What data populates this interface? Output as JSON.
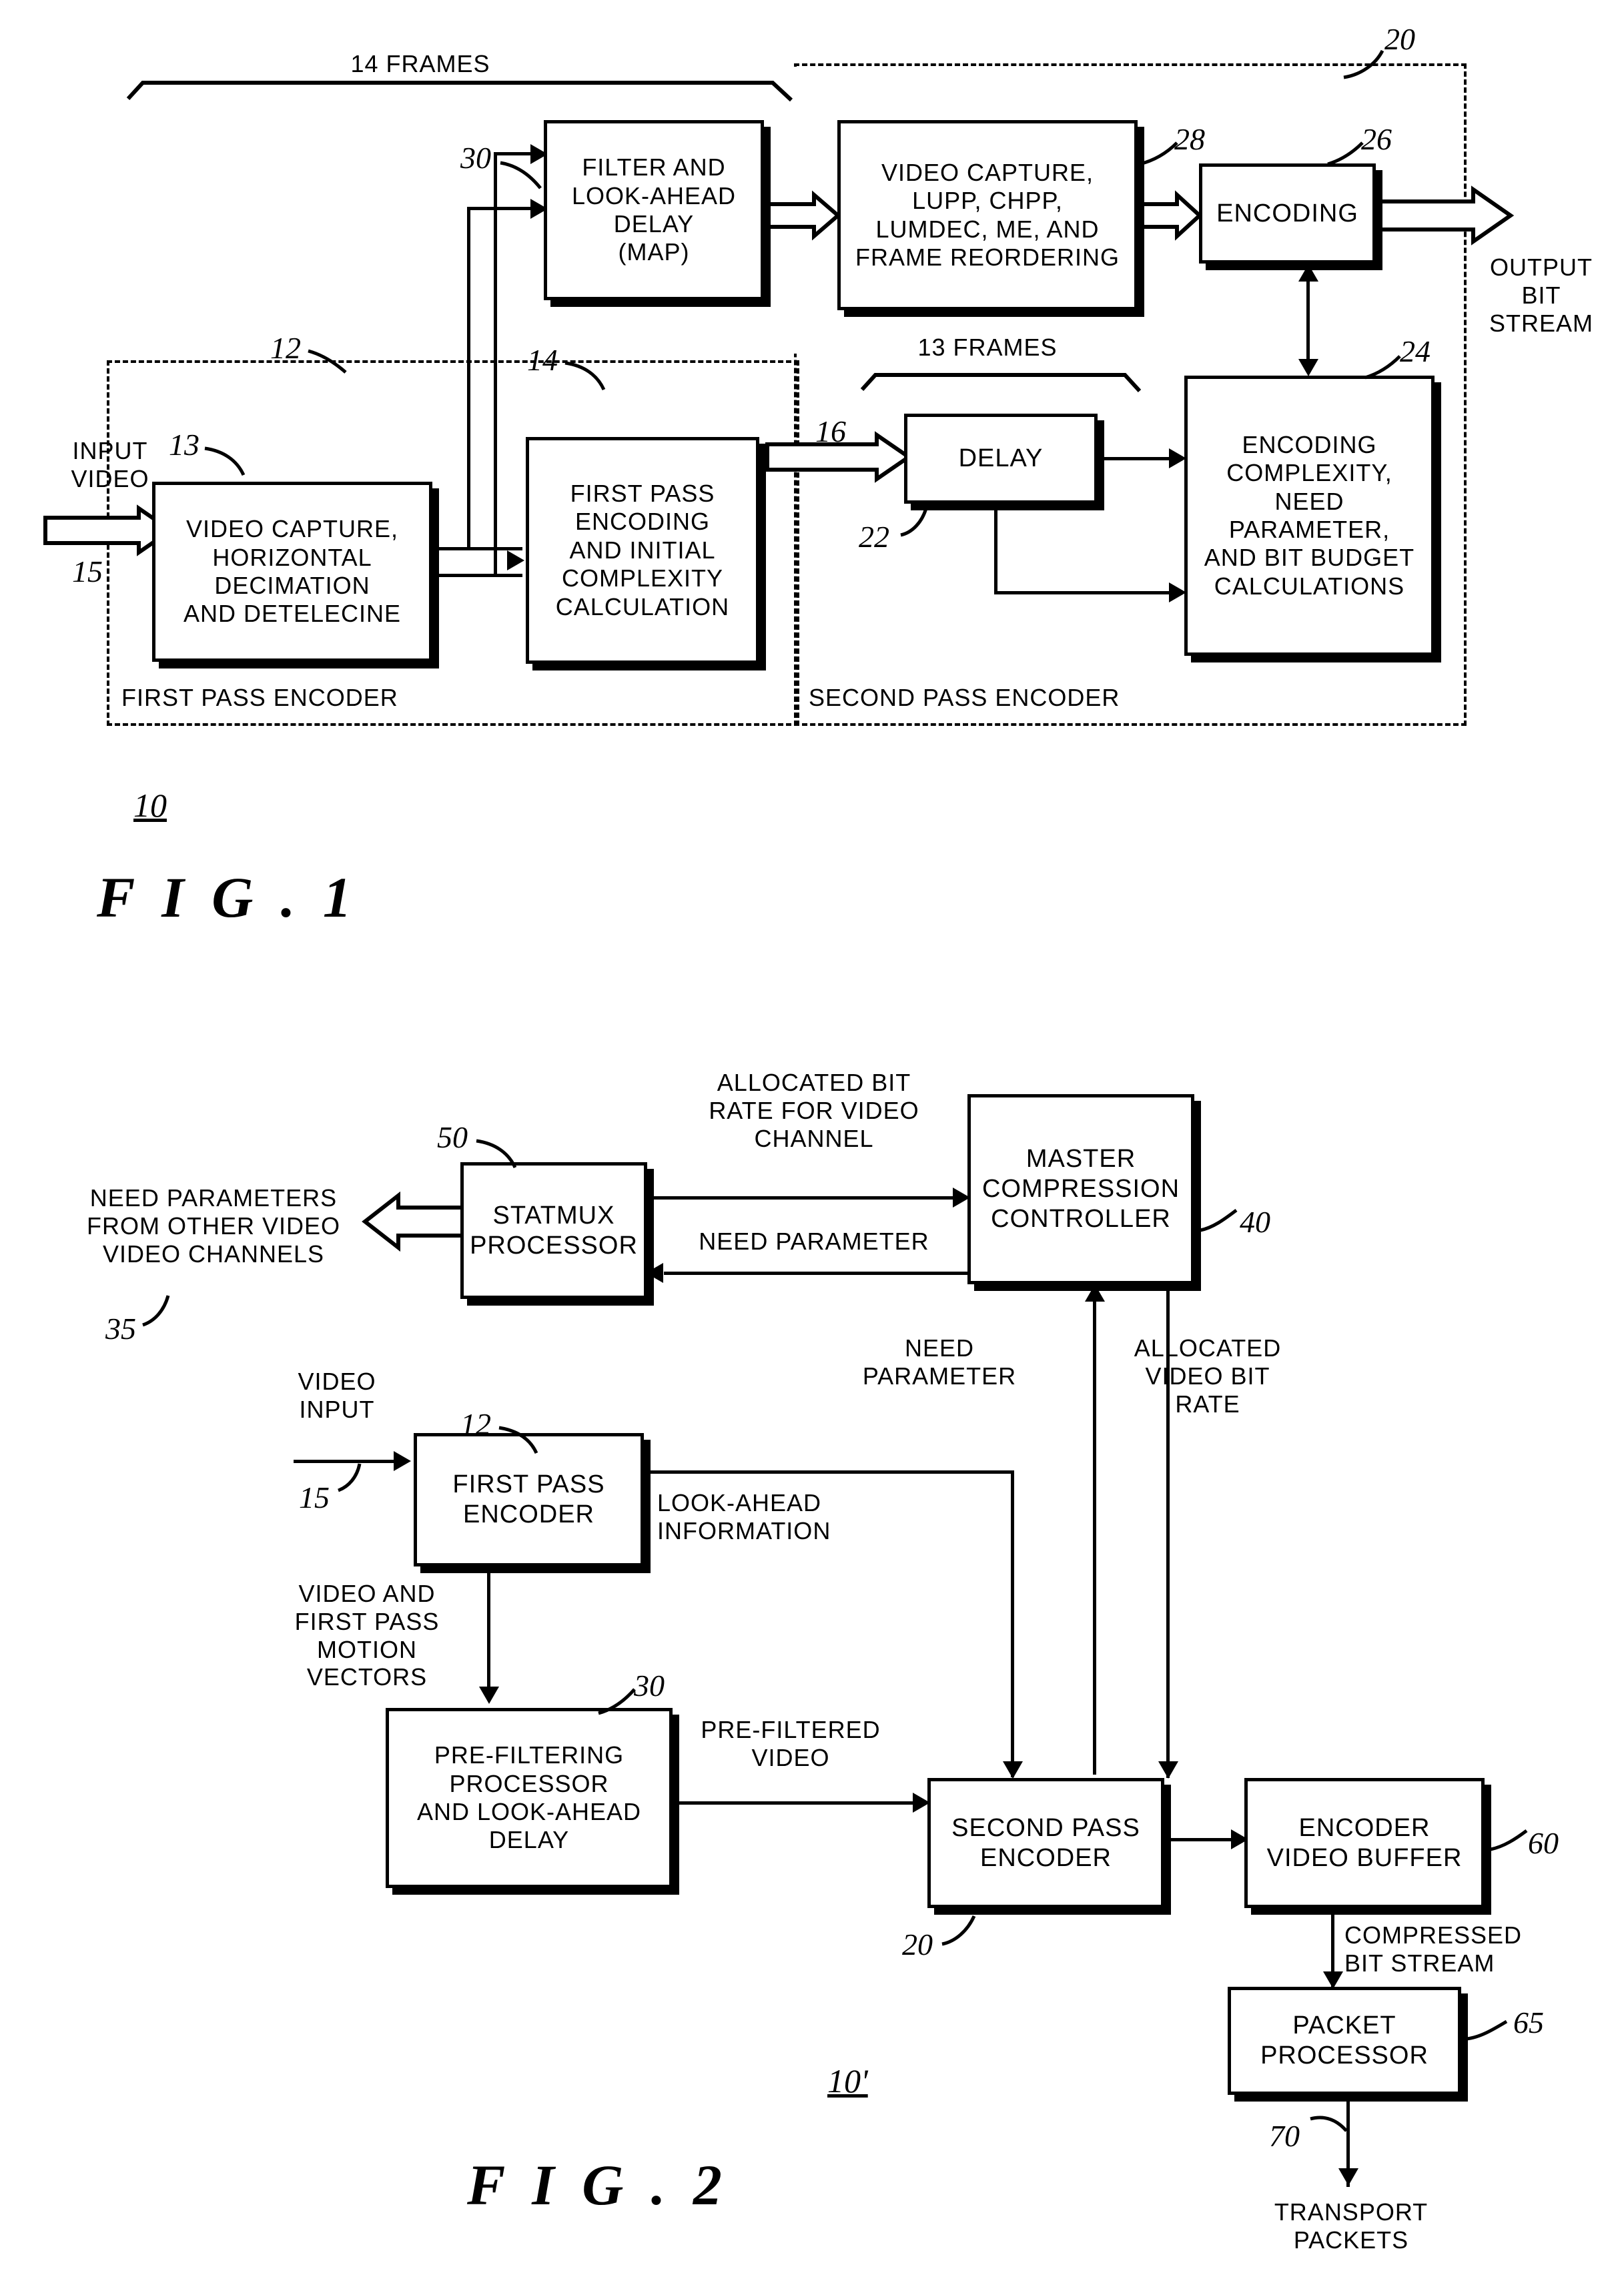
{
  "figure1": {
    "caption": "F I G .   1",
    "figure_ref": "10",
    "top_span_label": "14 FRAMES",
    "mid_span_label": "13 FRAMES",
    "input_label": "INPUT\nVIDEO",
    "output_label": "OUTPUT\nBIT\nSTREAM",
    "group_first_pass": "FIRST PASS ENCODER",
    "group_second_pass": "SECOND PASS ENCODER",
    "boxes": {
      "video_capture_horizontal": "VIDEO CAPTURE,\nHORIZONTAL\nDECIMATION\nAND DETELECINE",
      "first_pass_encoding": "FIRST PASS\nENCODING\nAND INITIAL\nCOMPLEXITY\nCALCULATION",
      "filter_lookahead": "FILTER AND\nLOOK-AHEAD\nDELAY\n(MAP)",
      "video_capture_lupp": "VIDEO CAPTURE,\nLUPP, CHPP,\nLUMDEC, ME, AND\nFRAME REORDERING",
      "encoding": "ENCODING",
      "delay": "DELAY",
      "encoding_complexity": "ENCODING\nCOMPLEXITY,\nNEED PARAMETER,\nAND BIT BUDGET\nCALCULATIONS"
    },
    "refs": {
      "r12": "12",
      "r13": "13",
      "r14": "14",
      "r15": "15",
      "r16": "16",
      "r20": "20",
      "r22": "22",
      "r24": "24",
      "r26": "26",
      "r28": "28",
      "r30": "30"
    }
  },
  "figure2": {
    "caption": "F I G .   2",
    "figure_ref": "10'",
    "boxes": {
      "statmux": "STATMUX\nPROCESSOR",
      "master_controller": "MASTER\nCOMPRESSION\nCONTROLLER",
      "first_pass_encoder": "FIRST PASS\nENCODER",
      "prefilter": "PRE-FILTERING\nPROCESSOR\nAND LOOK-AHEAD\nDELAY",
      "second_pass_encoder": "SECOND PASS\nENCODER",
      "encoder_video_buffer": "ENCODER\nVIDEO BUFFER",
      "packet_processor": "PACKET\nPROCESSOR"
    },
    "labels": {
      "need_params_other": "NEED PARAMETERS\nFROM OTHER VIDEO\nVIDEO CHANNELS",
      "allocated_bit_rate_channel": "ALLOCATED BIT\nRATE FOR VIDEO\nCHANNEL",
      "need_parameter": "NEED PARAMETER",
      "video_input": "VIDEO\nINPUT",
      "look_ahead_information": "LOOK-AHEAD\nINFORMATION",
      "video_and_first_pass_motion_vectors": "VIDEO AND\nFIRST PASS\nMOTION\nVECTORS",
      "need_parameter_up": "NEED\nPARAMETER",
      "allocated_video_bit_rate": "ALLOCATED\nVIDEO BIT\nRATE",
      "pre_filtered_video": "PRE-FILTERED\nVIDEO",
      "compressed_bit_stream": "COMPRESSED\nBIT STREAM",
      "transport_packets": "TRANSPORT\nPACKETS"
    },
    "refs": {
      "r12": "12",
      "r15": "15",
      "r20": "20",
      "r30": "30",
      "r35": "35",
      "r40": "40",
      "r50": "50",
      "r60": "60",
      "r65": "65",
      "r70": "70"
    }
  }
}
